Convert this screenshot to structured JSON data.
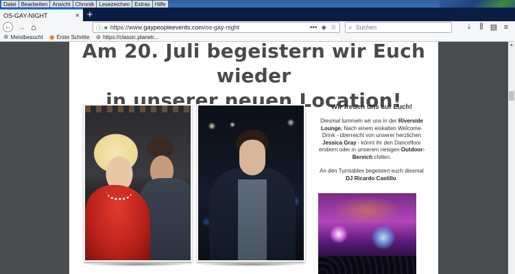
{
  "menubar": {
    "items": [
      "Datei",
      "Bearbeiten",
      "Ansicht",
      "Chronik",
      "Lesezeichen",
      "Extras",
      "Hilfe"
    ]
  },
  "tabs": [
    {
      "label": "OS-GAY-NIGHT",
      "close": "×"
    }
  ],
  "newtab": "+",
  "nav": {
    "back": "←",
    "forward": "→",
    "home": "⌂",
    "info_icon": "ⓘ",
    "lock_icon": "🔒",
    "url_prefix": "https://www.",
    "url_domain": "gaypeopleevents.com",
    "url_path": "/os-gay-night",
    "more_icon": "•••",
    "shield_icon": "◈",
    "star_icon": "☆",
    "search_placeholder": "Suchen",
    "search_icon": "⌕",
    "download_icon": "⤓",
    "library_icon": "⫼",
    "sidebar_icon": "▤",
    "menu_icon": "≡"
  },
  "bookmarks": [
    {
      "icon": "gear-icon",
      "glyph": "✲",
      "label": "Meistbesucht"
    },
    {
      "icon": "firefox-icon",
      "glyph": "◉",
      "label": "Erste Schritte"
    },
    {
      "icon": "globe-icon",
      "glyph": "⊕",
      "label": "https://classic.planetr..."
    }
  ],
  "page": {
    "heading_line1": "Am 20. Juli begeistern wir Euch wieder",
    "heading_line2": "in unserer neuen Location!",
    "sidebar_title": "Wir freuen uns auf Euch!",
    "para1_a": "Diesmal tummeln wir uns in der ",
    "para1_b": "Riverside Lounge.",
    "para1_c": " Nach einem eiskalten Welcome-Drink - überreicht von unserer herzlichen ",
    "para1_d": "Jessica Gray",
    "para1_e": " - könnt ihr den Dancefloor erobern oder in unserem riesigen ",
    "para1_f": "Outdoor-Bereich",
    "para1_g": " chillen.",
    "para2_a": "An den Turntables begeistert euch diesmal ",
    "para2_b": "DJ Ricardo Castillo",
    "para2_c": "."
  },
  "scrollbar": {
    "up_arrow": "▲"
  },
  "colors": {
    "accent": "#0a84ff",
    "tabstrip": "#0a1d45",
    "page_bg": "#4a4d50",
    "heading": "#4a4a4a",
    "lock": "#12bc00"
  }
}
